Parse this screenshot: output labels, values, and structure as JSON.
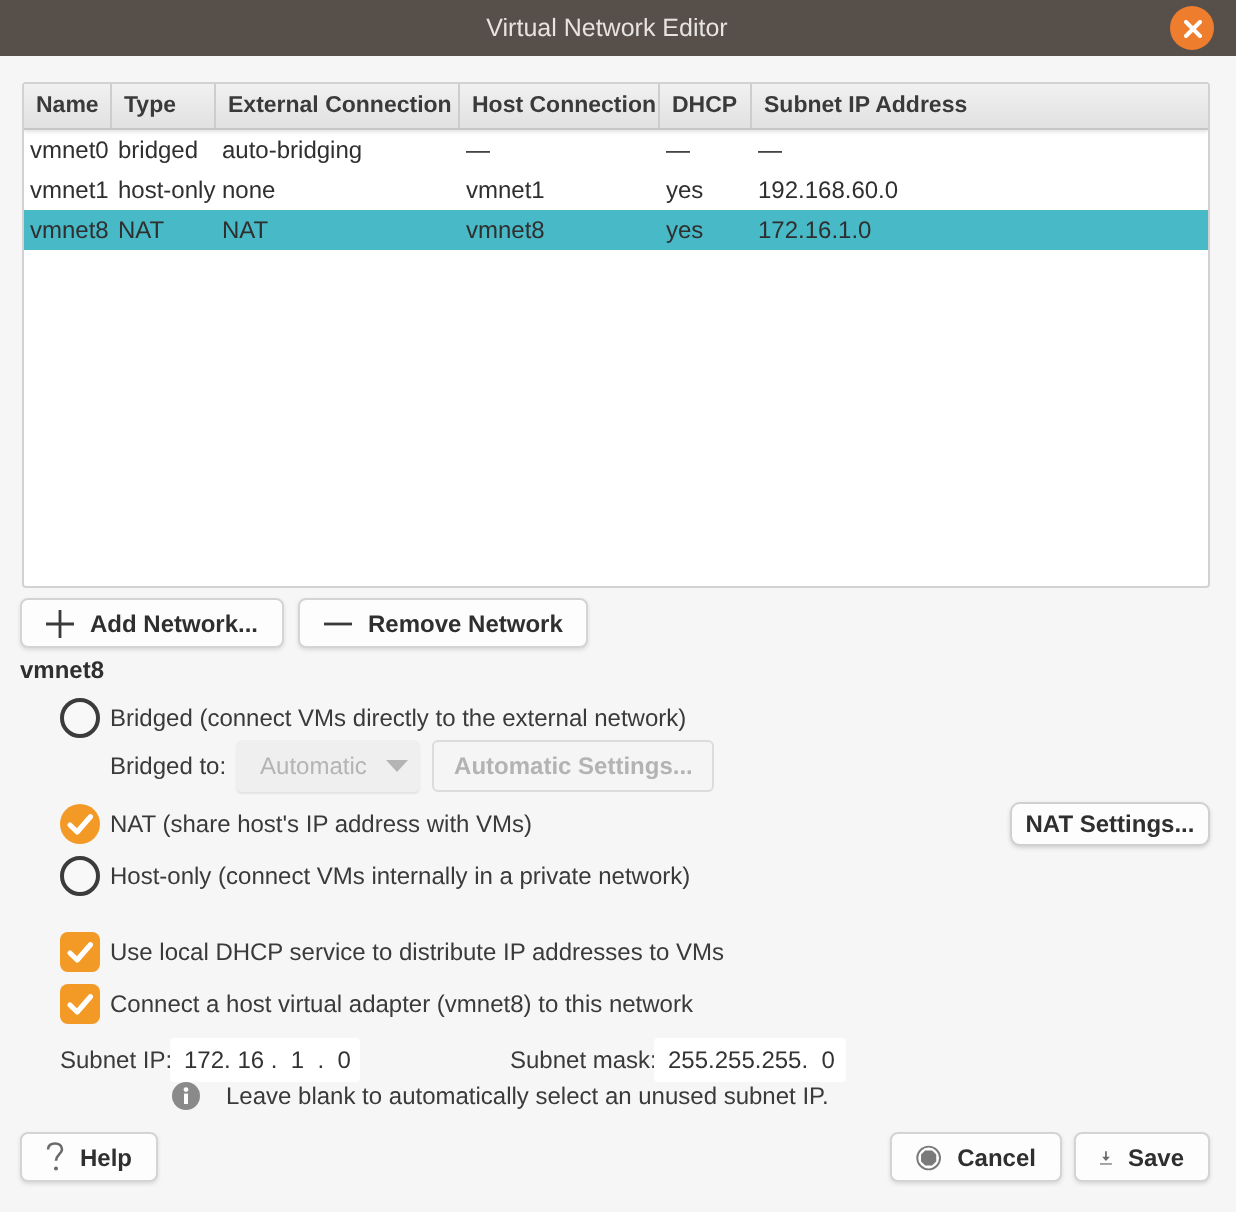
{
  "window": {
    "title": "Virtual Network Editor"
  },
  "table": {
    "columns": [
      "Name",
      "Type",
      "External Connection",
      "Host Connection",
      "DHCP",
      "Subnet IP Address"
    ],
    "rows": [
      {
        "cells": [
          "vmnet0",
          "bridged",
          "auto-bridging",
          "—",
          "—",
          "—"
        ],
        "selected": false
      },
      {
        "cells": [
          "vmnet1",
          "host-only",
          "none",
          "vmnet1",
          "yes",
          "192.168.60.0"
        ],
        "selected": false
      },
      {
        "cells": [
          "vmnet8",
          "NAT",
          "NAT",
          "vmnet8",
          "yes",
          "172.16.1.0"
        ],
        "selected": true
      }
    ]
  },
  "network_buttons": [
    {
      "kind": "add",
      "label": "Add Network..."
    },
    {
      "kind": "remove",
      "label": "Remove Network"
    }
  ],
  "settings": {
    "heading": "vmnet8",
    "modes": [
      {
        "label": "Bridged (connect VMs directly to the external network)",
        "selected": false,
        "bridged_to": {
          "label": "Bridged to:",
          "value": "Automatic",
          "button": "Automatic Settings...",
          "disabled": true
        }
      },
      {
        "label": "NAT (share host's IP address with VMs)",
        "selected": true,
        "button": "NAT Settings..."
      },
      {
        "label": "Host-only (connect VMs internally in a private network)",
        "selected": false
      }
    ],
    "options": [
      {
        "label": "Use local DHCP service to distribute IP addresses to VMs",
        "checked": true
      },
      {
        "label": "Connect a host virtual adapter (vmnet8) to this network",
        "checked": true
      }
    ],
    "subnet_ip": {
      "label": "Subnet IP:",
      "value": "172. 16 .  1  .  0"
    },
    "subnet_mask": {
      "label": "Subnet mask:",
      "value": "255.255.255.  0"
    },
    "hint": "Leave blank to automatically select an unused subnet IP."
  },
  "footer": [
    {
      "kind": "help",
      "label": "Help"
    },
    {
      "kind": "cancel",
      "label": "Cancel"
    },
    {
      "kind": "save",
      "label": "Save"
    }
  ]
}
